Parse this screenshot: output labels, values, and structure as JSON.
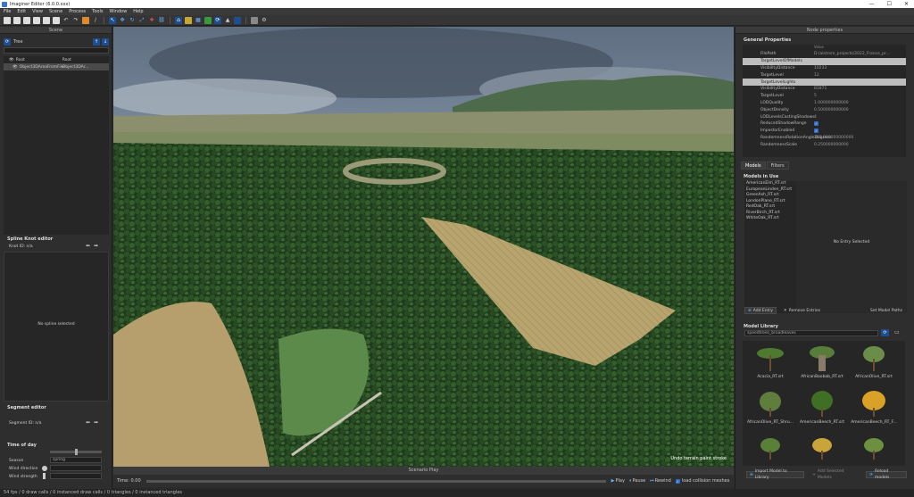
{
  "window": {
    "title": "Imaginer Editor (6.0.0.xxx)",
    "minimize": "—",
    "maximize": "☐",
    "close": "✕"
  },
  "menu": [
    "File",
    "Edit",
    "View",
    "Scene",
    "Process",
    "Tools",
    "Window",
    "Help"
  ],
  "left": {
    "scene_header": "Scene",
    "tree_label": "Tree",
    "rows": [
      {
        "name": "Root",
        "right": "Root"
      },
      {
        "name": "Object3DAreaFromFile",
        "right": "Object3DAr..."
      }
    ],
    "spline_title": "Spline Knot editor",
    "knot_id": "Knot ID: n/a",
    "no_spline": "No spline selected",
    "segment_title": "Segment editor",
    "segment_id": "Segment ID: n/a",
    "time_title": "Time of day",
    "season_label": "Season",
    "season_value": "spring",
    "wind_dir_label": "Wind direction",
    "wind_str_label": "Wind strength"
  },
  "viewport": {
    "undo_text": "Undo terrain paint stroke"
  },
  "scenario": {
    "header": "Scenario Play",
    "time": "Time: 0.00",
    "play": "Play",
    "pause": "Pause",
    "rewind": "Rewind",
    "load_collision": "load collision meshes"
  },
  "status": "54 fps / 0 draw calls / 0 instanced draw calls / 0 triangles / 0 instanced triangles",
  "right": {
    "header": "Node properties",
    "general": "General Properties",
    "value_head": "Value",
    "props": [
      {
        "k": "FilePath",
        "v": "D:/alstrom_projects/2022_France_pr...",
        "type": "row"
      },
      {
        "k": "TargetLevelOfModels",
        "v": "",
        "type": "group"
      },
      {
        "k": "VisibilityDistance",
        "v": "10233",
        "type": "row"
      },
      {
        "k": "TargetLevel",
        "v": "12",
        "type": "row"
      },
      {
        "k": "TargetLevelLights",
        "v": "",
        "type": "group"
      },
      {
        "k": "VisibilityDistance",
        "v": "81871",
        "type": "row"
      },
      {
        "k": "TargetLevel",
        "v": "5",
        "type": "row"
      },
      {
        "k": "LODQuality",
        "v": "1.000000000000",
        "type": "row"
      },
      {
        "k": "ObjectDensity",
        "v": "0.500000000000",
        "type": "row"
      },
      {
        "k": "LODLevelsCastingShadows",
        "v": "4",
        "type": "row"
      },
      {
        "k": "ReducedShadowRange",
        "v": "",
        "type": "check"
      },
      {
        "k": "ImpostorEnabled",
        "v": "",
        "type": "check"
      },
      {
        "k": "RandomnessRotationAngleDegrees",
        "v": "360.000000000000",
        "type": "row"
      },
      {
        "k": "RandomnessScale",
        "v": "0.250000000000",
        "type": "row"
      }
    ],
    "tabs": [
      "Models",
      "Filters"
    ],
    "models_title": "Models in Use",
    "models": [
      "AmericanElm_RT.srt",
      "EuropeanLinden_RT.srt",
      "GreenAsh_RT.srt",
      "LondonPlane_RT.srt",
      "RedOak_RT.srt",
      "RiverBirch_RT.srt",
      "WhiteOak_RT.srt"
    ],
    "no_entry": "No Entry Selected",
    "add_entry": "Add Entry",
    "remove_entries": "Remove Entries",
    "set_paths": "Set Model Paths",
    "library_title": "Model Library",
    "library_filter": "speedtrees_broadleaves",
    "library": [
      "Acacia_RT.srt",
      "AfricanBaobab_RT.srt",
      "AfricanOlive_RT.srt",
      "AfricanOlive_RT_Shru...",
      "AmericanBeech_RT.srt",
      "AmericanBeech_RT_F..."
    ],
    "import_btn": "Import Model to Library",
    "add_selected": "Add Selected Models",
    "reload": "Reload models"
  },
  "colors": {
    "accent": "#2f6fd0",
    "panel": "#2e2e2e",
    "header": "#3a3a3a"
  }
}
